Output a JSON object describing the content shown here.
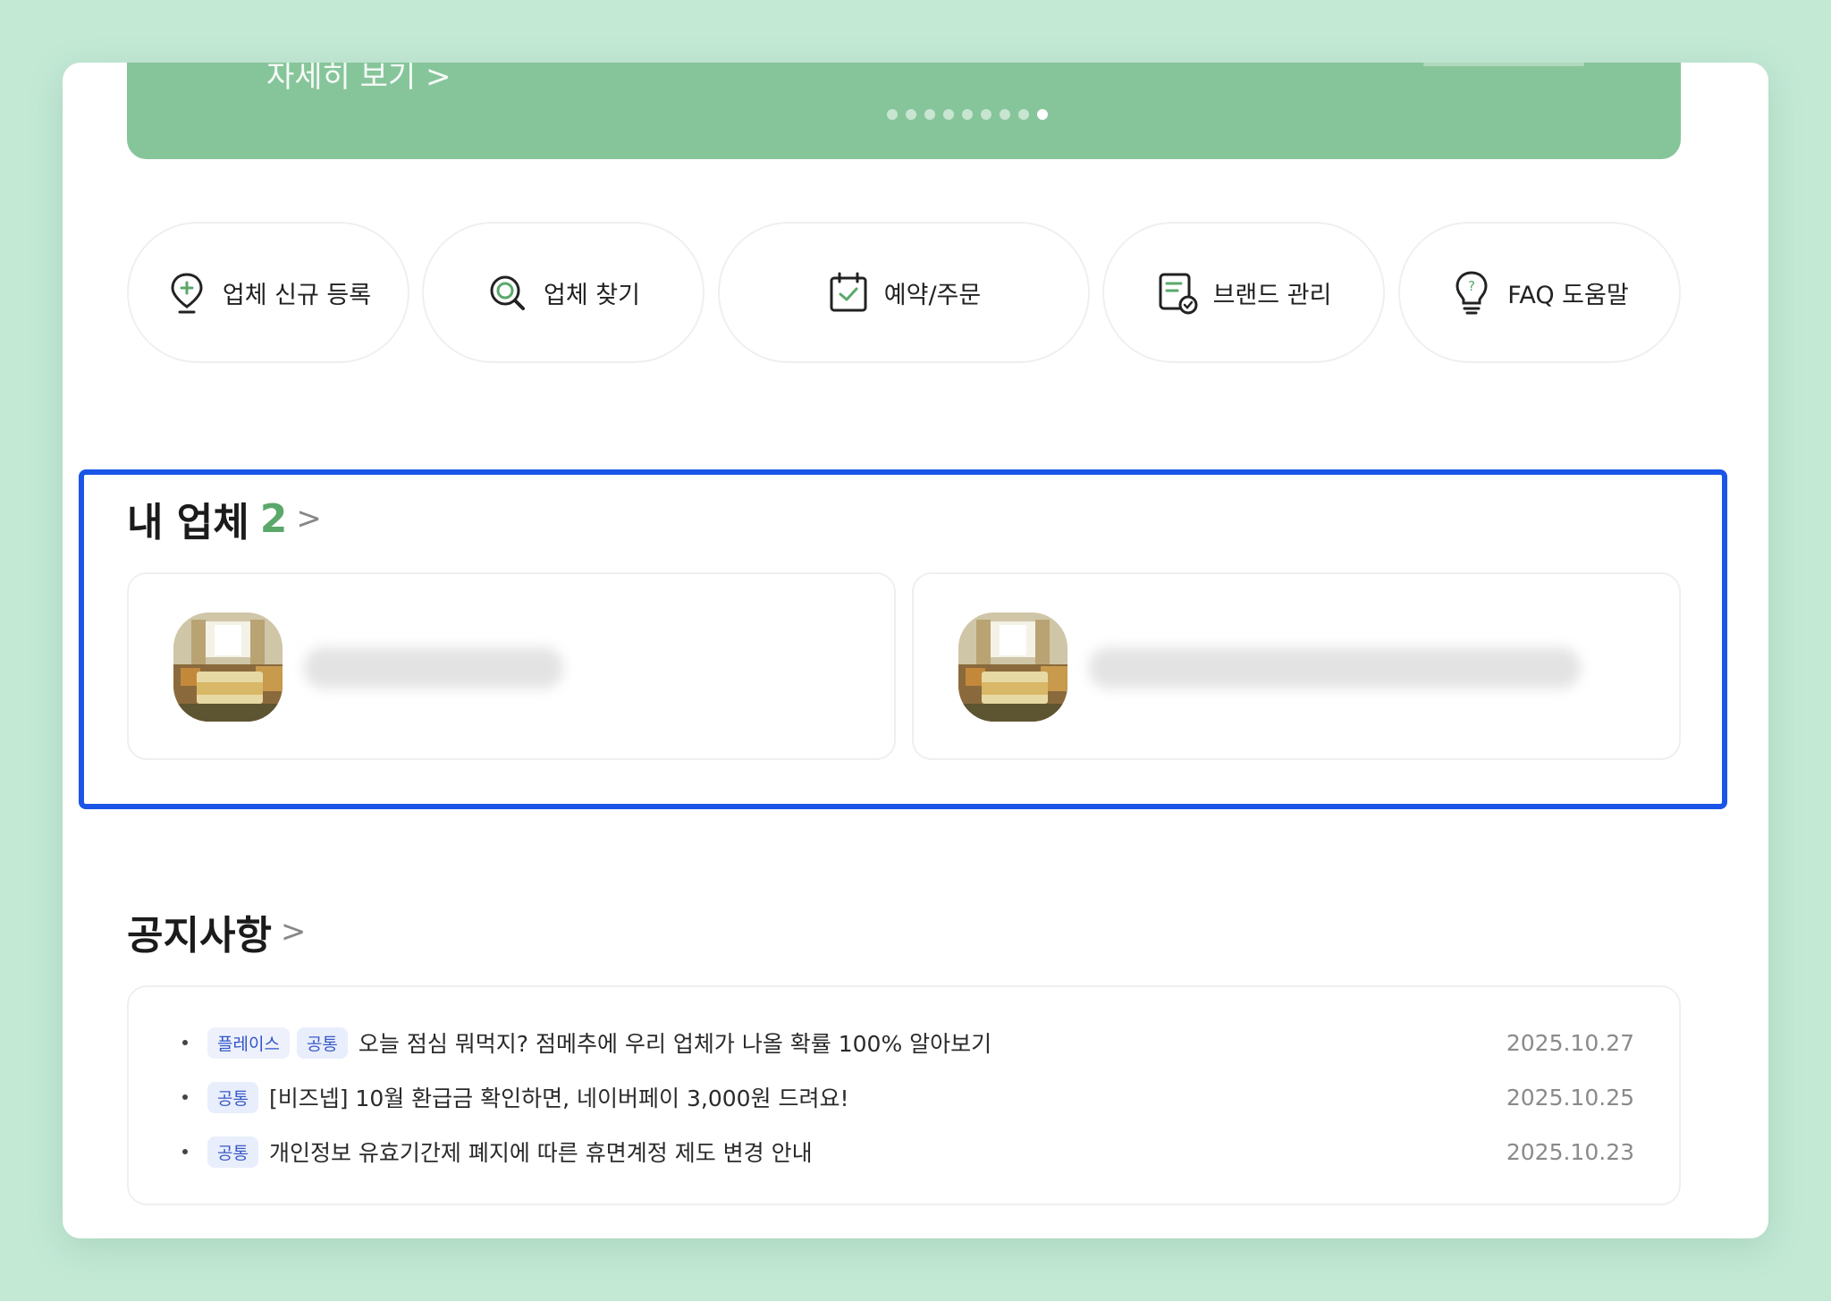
{
  "banner": {
    "link_label": "자세히 보기 >",
    "slide_count": 9,
    "active_slide": 9
  },
  "quick_menu": [
    {
      "label": "업체 신규 등록",
      "icon": "pin-plus-icon"
    },
    {
      "label": "업체 찾기",
      "icon": "search-icon"
    },
    {
      "label": "예약/주문",
      "icon": "calendar-check-icon"
    },
    {
      "label": "브랜드 관리",
      "icon": "document-check-icon"
    },
    {
      "label": "FAQ 도움말",
      "icon": "lightbulb-question-icon"
    }
  ],
  "my_business": {
    "title": "내 업체",
    "count": "2",
    "chevron": ">",
    "cards": [
      {
        "thumbnail": "hotel-room-image"
      },
      {
        "thumbnail": "hotel-room-image"
      }
    ]
  },
  "notices": {
    "title": "공지사항",
    "chevron": ">",
    "items": [
      {
        "tags": [
          "플레이스",
          "공통"
        ],
        "title": "오늘 점심 뭐먹지? 점메추에 우리 업체가 나올 확률 100% 알아보기",
        "date": "2025.10.27"
      },
      {
        "tags": [
          "공통"
        ],
        "title": "[비즈넵] 10월 환급금 확인하면, 네이버페이 3,000원 드려요!",
        "date": "2025.10.25"
      },
      {
        "tags": [
          "공통"
        ],
        "title": "개인정보 유효기간제 폐지에 따른 휴면계정 제도 변경 안내",
        "date": "2025.10.23"
      }
    ]
  },
  "colors": {
    "background": "#c3e9d5",
    "banner": "#86c59a",
    "accent": "#5aa86a",
    "highlight": "#1a55e8",
    "tag_text": "#3a5bc8"
  }
}
